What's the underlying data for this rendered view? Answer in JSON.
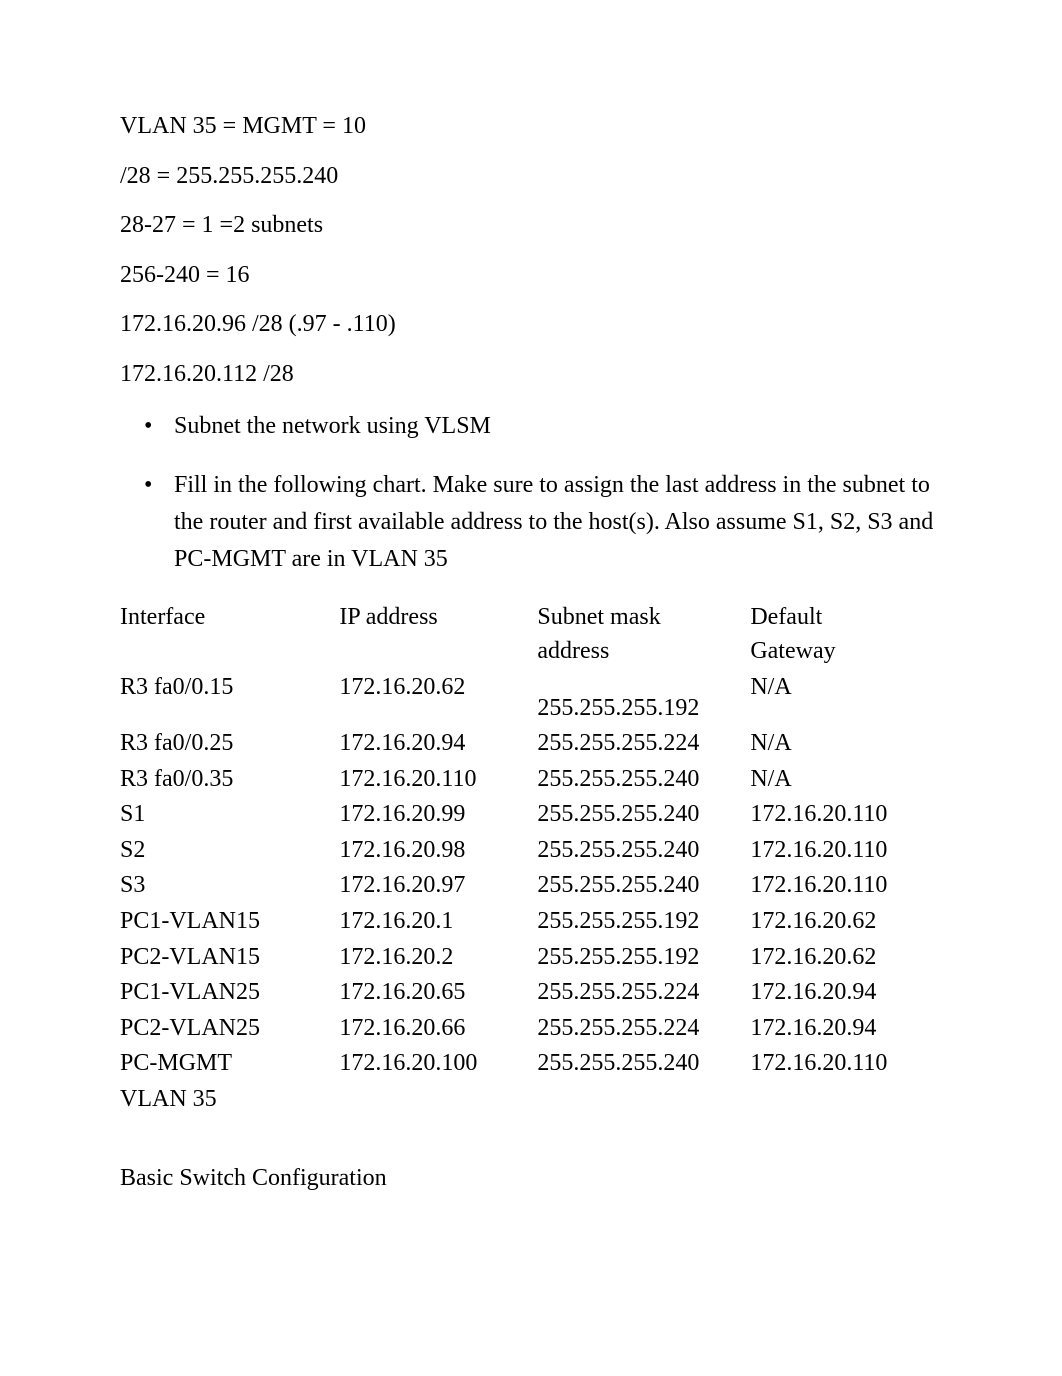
{
  "pre_lines": [
    "VLAN 35 = MGMT = 10",
    "/28 = 255.255.255.240",
    "28-27 = 1 =2 subnets",
    "256-240 = 16",
    "172.16.20.96 /28 (.97 - .110)",
    "172.16.20.112 /28"
  ],
  "bullets": [
    "Subnet the network using VLSM",
    "Fill in the following chart. Make sure to assign the last address in the subnet to the router and first available address to the host(s). Also assume S1, S2, S3 and PC-MGMT are in VLAN 35"
  ],
  "table": {
    "headers": {
      "interface": "Interface",
      "ip": "IP address",
      "mask_line1": "Subnet mask",
      "mask_line2": "address",
      "gw_line1": "Default",
      "gw_line2": "Gateway"
    },
    "rows": [
      {
        "iface": "R3 fa0/0.15",
        "ip": "172.16.20.62",
        "mask": "255.255.255.192",
        "gw": " N/A",
        "mask_offset": true
      },
      {
        "iface": "R3 fa0/0.25",
        "ip": "172.16.20.94",
        "mask": "255.255.255.224",
        "gw": "N/A"
      },
      {
        "iface": "R3 fa0/0.35",
        "ip": "172.16.20.110",
        "mask": "255.255.255.240",
        "gw": "N/A"
      },
      {
        "iface": "S1",
        "ip": "172.16.20.99",
        "mask": "255.255.255.240",
        "gw": "172.16.20.110"
      },
      {
        "iface": "S2",
        "ip": "172.16.20.98",
        "mask": "255.255.255.240",
        "gw": "172.16.20.110"
      },
      {
        "iface": "S3",
        "ip": "172.16.20.97",
        "mask": "255.255.255.240",
        "gw": "172.16.20.110"
      },
      {
        "iface": "PC1-VLAN15",
        "ip": "172.16.20.1",
        "mask": "255.255.255.192",
        "gw": "172.16.20.62"
      },
      {
        "iface": "PC2-VLAN15",
        "ip": "172.16.20.2",
        "mask": "255.255.255.192",
        "gw": "172.16.20.62"
      },
      {
        "iface": "PC1-VLAN25",
        "ip": "172.16.20.65",
        "mask": "255.255.255.224",
        "gw": "172.16.20.94"
      },
      {
        "iface": "PC2-VLAN25",
        "ip": "172.16.20.66",
        "mask": "255.255.255.224",
        "gw": "172.16.20.94"
      },
      {
        "iface": "PC-MGMT",
        "ip": "172.16.20.100",
        "mask": "255.255.255.240",
        "gw": "172.16.20.110"
      },
      {
        "iface": "VLAN 35",
        "ip": "",
        "mask": "",
        "gw": ""
      }
    ]
  },
  "section_title": "Basic Switch Configuration"
}
